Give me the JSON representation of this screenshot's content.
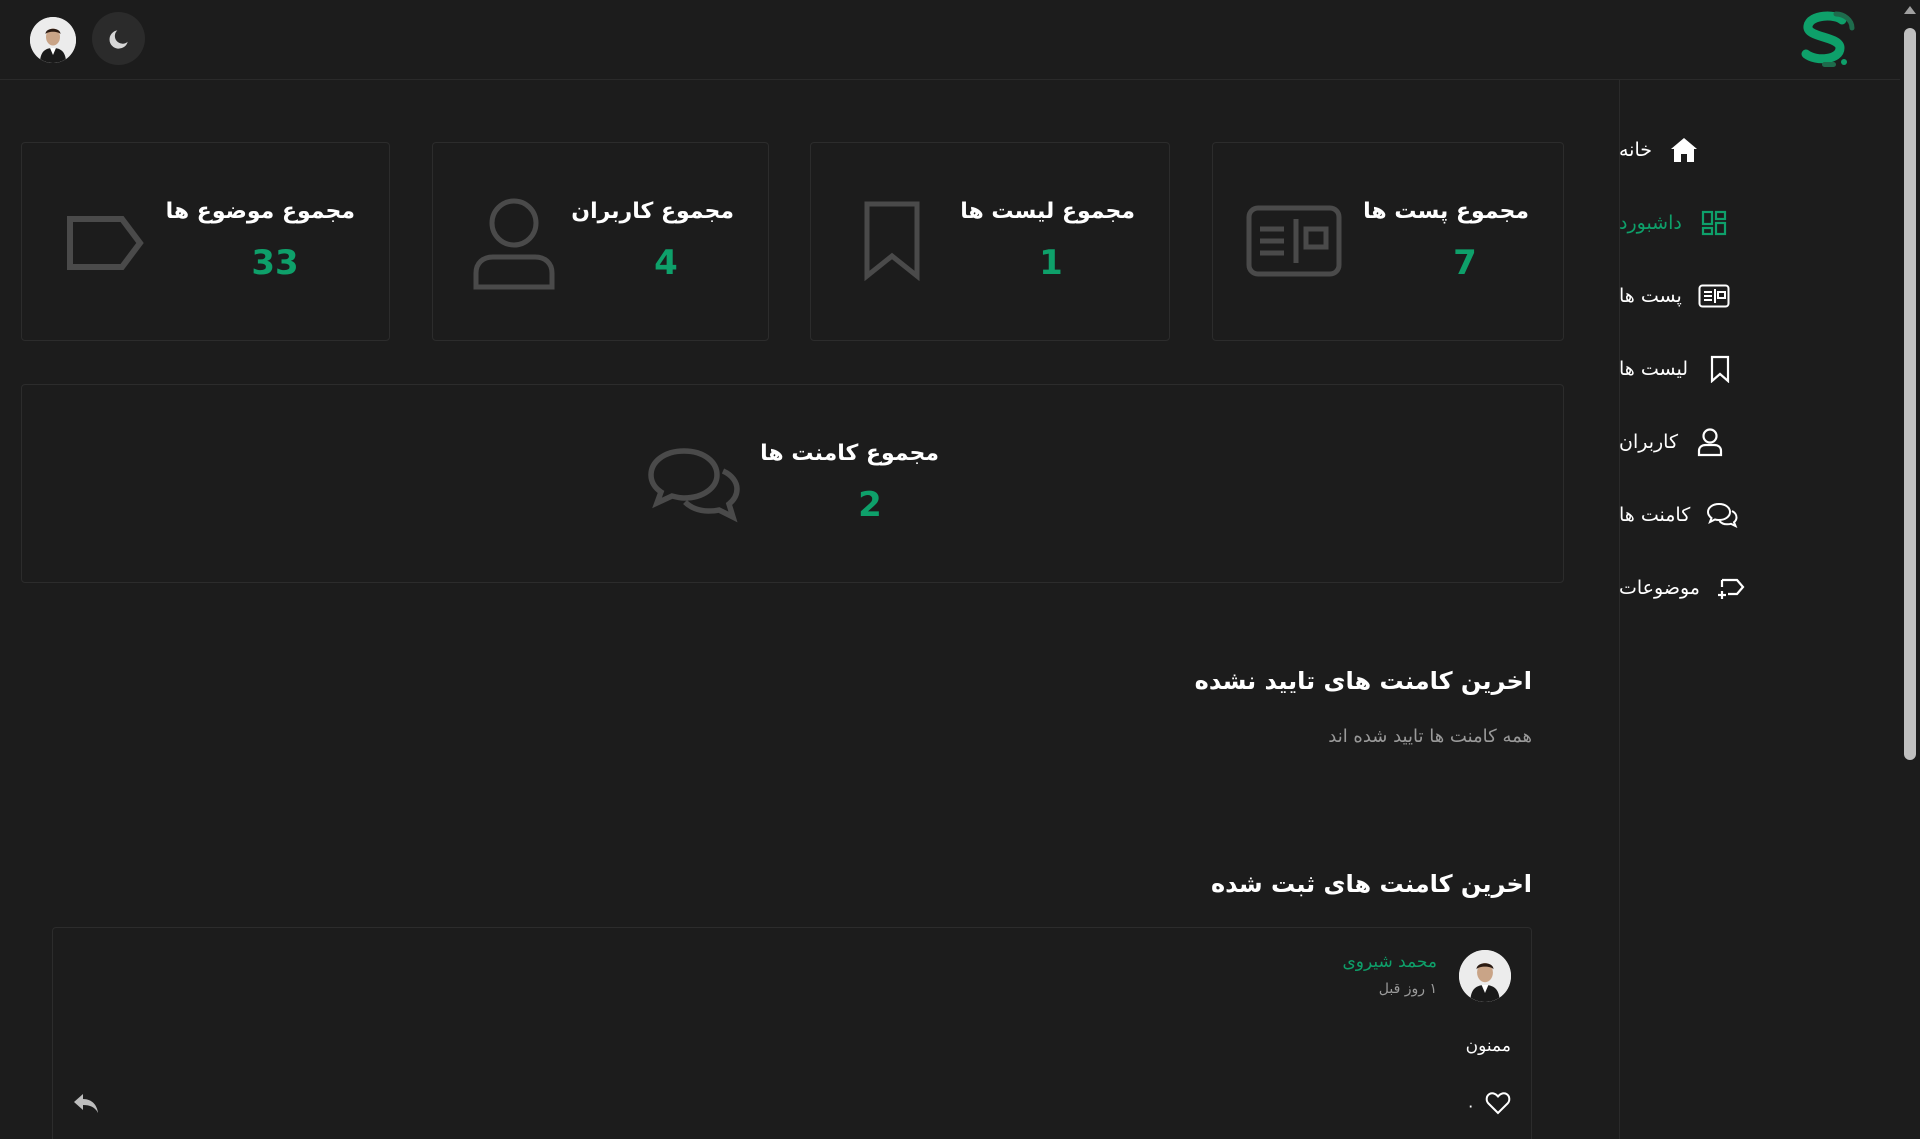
{
  "header": {
    "logo_icon": "brand-s-logo-icon",
    "theme_toggle_icon": "moon-icon",
    "avatar_icon": "user-avatar"
  },
  "sidebar": {
    "items": [
      {
        "label": "خانه",
        "icon": "home-icon",
        "active": false
      },
      {
        "label": "داشبورد",
        "icon": "dashboard-icon",
        "active": true
      },
      {
        "label": "پست ها",
        "icon": "newspaper-icon",
        "active": false
      },
      {
        "label": "لیست ها",
        "icon": "bookmark-icon",
        "active": false
      },
      {
        "label": "کاربران",
        "icon": "user-icon",
        "active": false
      },
      {
        "label": "کامنت ها",
        "icon": "comments-icon",
        "active": false
      },
      {
        "label": "موضوعات",
        "icon": "topics-tag-icon",
        "active": false
      }
    ]
  },
  "stats": {
    "posts": {
      "title": "مجموع پست ها",
      "value": "7",
      "icon": "newspaper-icon"
    },
    "lists": {
      "title": "مجموع لیست ها",
      "value": "1",
      "icon": "bookmark-icon"
    },
    "users": {
      "title": "مجموع کاربران",
      "value": "4",
      "icon": "user-icon"
    },
    "topics": {
      "title": "مجموع موضوع ها",
      "value": "33",
      "icon": "tag-icon"
    },
    "comments": {
      "title": "مجموع کامنت ها",
      "value": "2",
      "icon": "comments-icon"
    }
  },
  "unapproved": {
    "title": "اخرین کامنت های تایید نشده",
    "empty_text": "همه کامنت ها تایید شده اند"
  },
  "recent": {
    "title": "اخرین کامنت های ثبت شده",
    "comments": [
      {
        "author": "محمد شیروی",
        "time": "۱ روز قبل",
        "text": "ممنون",
        "likes": "۰"
      }
    ]
  },
  "colors": {
    "accent": "#0ea06a",
    "background": "#1c1c1c",
    "border": "#2c2c2c",
    "icon_muted": "#4a4a4a"
  }
}
